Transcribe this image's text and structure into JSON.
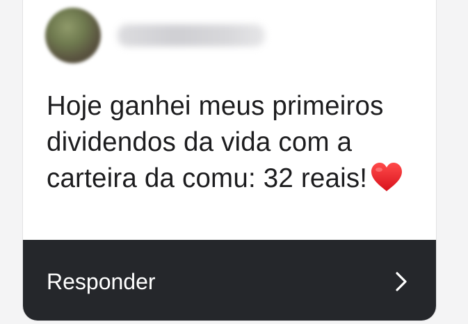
{
  "comment": {
    "author_name": "username",
    "text": "Hoje ganhei meus primeiros dividendos da vida com a carteira da comu: 32 reais!",
    "emoji": "red-heart-icon"
  },
  "reply": {
    "label": "Responder",
    "icon": "chevron-right-icon"
  },
  "colors": {
    "card_bg": "#ffffff",
    "reply_bar_bg": "#25272b",
    "heart": "#e0202a"
  }
}
